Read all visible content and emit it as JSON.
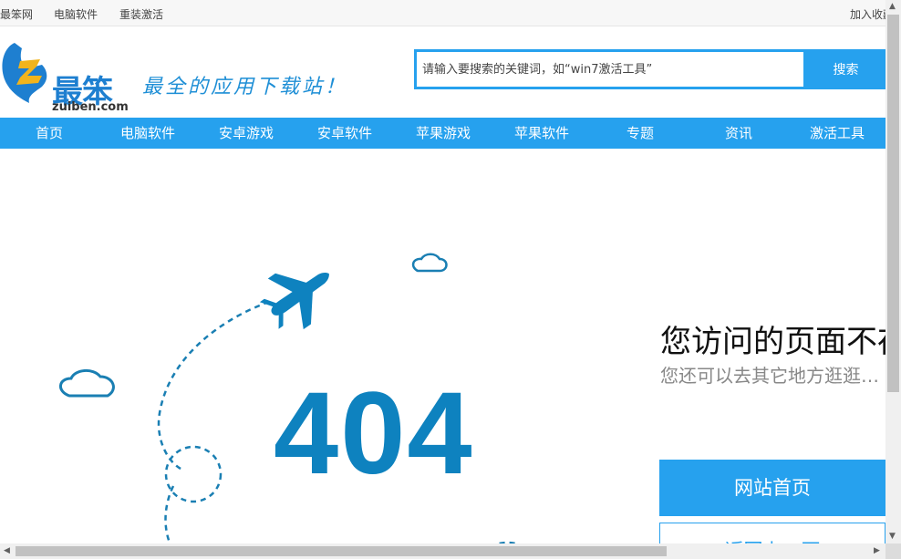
{
  "topbar": {
    "site_name": "最笨网",
    "links": [
      "电脑软件",
      "重装激活"
    ],
    "bookmark": "加入收藏"
  },
  "logo": {
    "mark": "最笨",
    "domain": "zuiben.com",
    "slogan": "最全的应用下载站！",
    "colors": {
      "blue": "#1e7fd0",
      "yellow": "#f1b41c"
    }
  },
  "search": {
    "placeholder": "请输入要搜索的关键词，如“win7激活工具”",
    "button": "搜索"
  },
  "nav": {
    "items": [
      "首页",
      "电脑软件",
      "安卓游戏",
      "安卓软件",
      "苹果游戏",
      "苹果软件",
      "专题",
      "资讯",
      "激活工具"
    ]
  },
  "error": {
    "code": "404",
    "title": "您访问的页面不存在",
    "subtitle": "您还可以去其它地方逛逛…",
    "home_button": "网站首页",
    "back_button": "返回上一页"
  },
  "theme": {
    "accent": "#26a1ee",
    "error_blue": "#0e82bf"
  },
  "icons": [
    "airplane-icon",
    "cloud-icon",
    "scroll-up-arrow-icon",
    "scroll-down-arrow-icon",
    "scroll-left-arrow-icon",
    "scroll-right-arrow-icon"
  ]
}
